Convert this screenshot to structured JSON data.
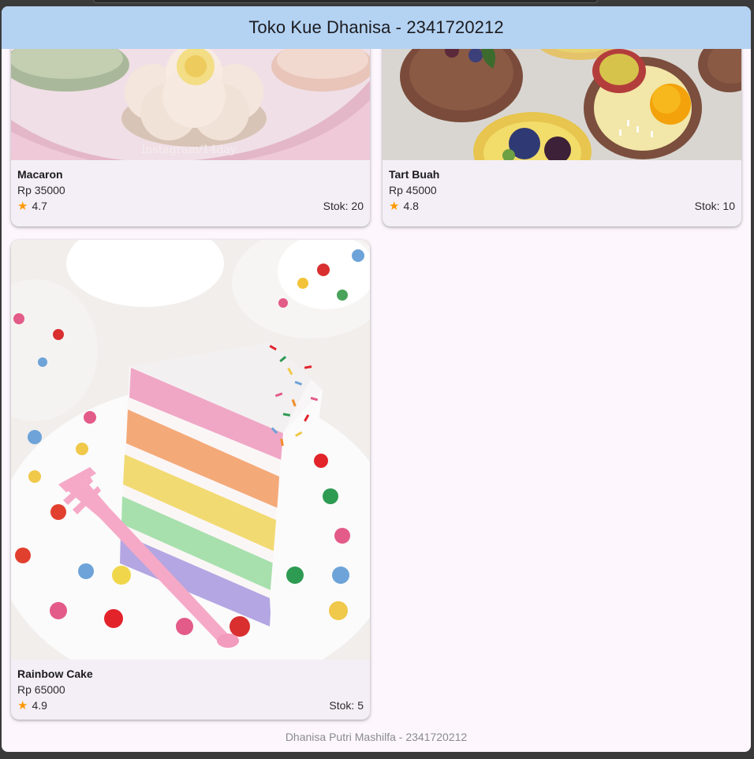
{
  "app": {
    "title": "Toko Kue Dhanisa - 2341720212"
  },
  "products": [
    {
      "name": "Macaron",
      "price": "Rp 35000",
      "rating": "4.7",
      "stock": "Stok: 20",
      "image_watermark": "Instagram/14day"
    },
    {
      "name": "Tart Buah",
      "price": "Rp 45000",
      "rating": "4.8",
      "stock": "Stok: 10"
    },
    {
      "name": "Rainbow Cake",
      "price": "Rp 65000",
      "rating": "4.9",
      "stock": "Stok: 5"
    }
  ],
  "footer": {
    "credit": "Dhanisa Putri Mashilfa - 2341720212"
  },
  "colors": {
    "appbar": "#b4d2f2",
    "card": "#f4eff6",
    "star": "#ff9800",
    "background": "#fdf7fd"
  },
  "icons": {
    "rating": "star-icon"
  }
}
